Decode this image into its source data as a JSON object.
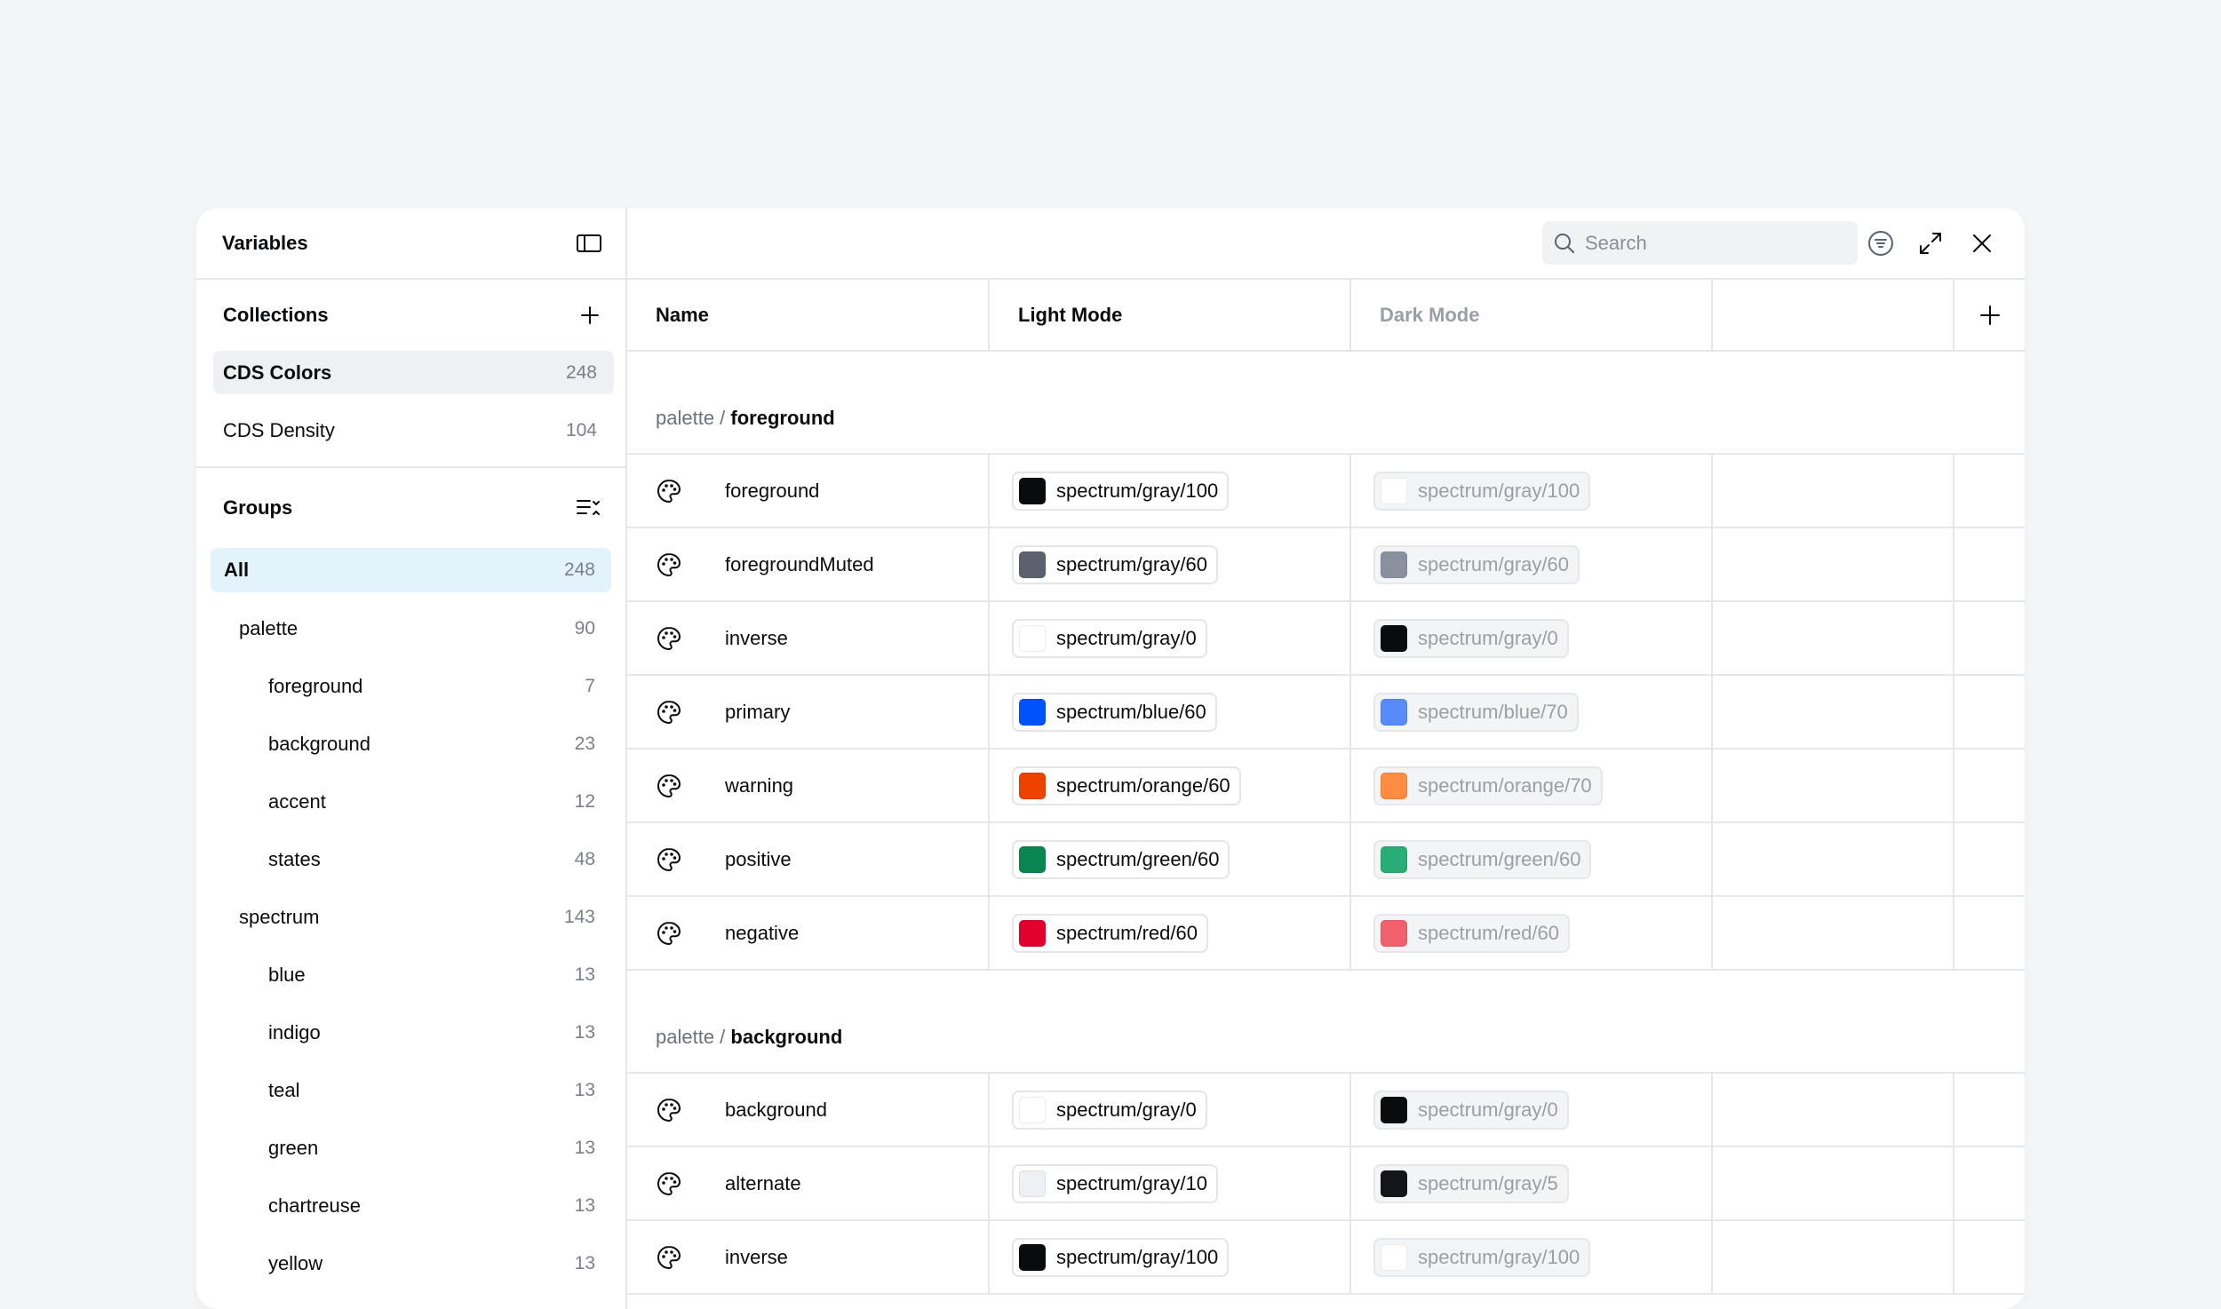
{
  "sidebar": {
    "title": "Variables",
    "collections_heading": "Collections",
    "collections": [
      {
        "label": "CDS Colors",
        "count": "248"
      },
      {
        "label": "CDS Density",
        "count": "104"
      }
    ],
    "groups_heading": "Groups",
    "groups": [
      {
        "label": "All",
        "count": "248"
      },
      {
        "label": "palette",
        "count": "90"
      },
      {
        "label": "foreground",
        "count": "7"
      },
      {
        "label": "background",
        "count": "23"
      },
      {
        "label": "accent",
        "count": "12"
      },
      {
        "label": "states",
        "count": "48"
      },
      {
        "label": "spectrum",
        "count": "143"
      },
      {
        "label": "blue",
        "count": "13"
      },
      {
        "label": "indigo",
        "count": "13"
      },
      {
        "label": "teal",
        "count": "13"
      },
      {
        "label": "green",
        "count": "13"
      },
      {
        "label": "chartreuse",
        "count": "13"
      },
      {
        "label": "yellow",
        "count": "13"
      }
    ]
  },
  "toolbar": {
    "search_placeholder": "Search",
    "icons": [
      "search-icon",
      "filter-icon",
      "expand-icon",
      "close-icon"
    ]
  },
  "table": {
    "headers": {
      "name": "Name",
      "light": "Light Mode",
      "dark": "Dark Mode"
    },
    "sections": [
      {
        "prefix": "palette / ",
        "name": "foreground",
        "rows": [
          {
            "name": "foreground",
            "light": "spectrum/gray/100",
            "light_color": "#0a0b0d",
            "dark": "spectrum/gray/100",
            "dark_color": "#ffffff"
          },
          {
            "name": "foregroundMuted",
            "light": "spectrum/gray/60",
            "light_color": "#5b616e",
            "dark": "spectrum/gray/60",
            "dark_color": "#8a919e"
          },
          {
            "name": "inverse",
            "light": "spectrum/gray/0",
            "light_color": "#ffffff",
            "dark": "spectrum/gray/0",
            "dark_color": "#0a0b0d"
          },
          {
            "name": "primary",
            "light": "spectrum/blue/60",
            "light_color": "#0052ff",
            "dark": "spectrum/blue/70",
            "dark_color": "#578bfa"
          },
          {
            "name": "warning",
            "light": "spectrum/orange/60",
            "light_color": "#ed4200",
            "dark": "spectrum/orange/70",
            "dark_color": "#ff8c42"
          },
          {
            "name": "positive",
            "light": "spectrum/green/60",
            "light_color": "#098551",
            "dark": "spectrum/green/60",
            "dark_color": "#27ad75"
          },
          {
            "name": "negative",
            "light": "spectrum/red/60",
            "light_color": "#e2012d",
            "dark": "spectrum/red/60",
            "dark_color": "#f0616d"
          }
        ]
      },
      {
        "prefix": "palette / ",
        "name": "background",
        "rows": [
          {
            "name": "background",
            "light": "spectrum/gray/0",
            "light_color": "#ffffff",
            "dark": "spectrum/gray/0",
            "dark_color": "#0a0b0d"
          },
          {
            "name": "alternate",
            "light": "spectrum/gray/10",
            "light_color": "#eef0f3",
            "dark": "spectrum/gray/5",
            "dark_color": "#141519"
          },
          {
            "name": "inverse",
            "light": "spectrum/gray/100",
            "light_color": "#0a0b0d",
            "dark": "spectrum/gray/100",
            "dark_color": "#ffffff"
          }
        ]
      }
    ]
  }
}
